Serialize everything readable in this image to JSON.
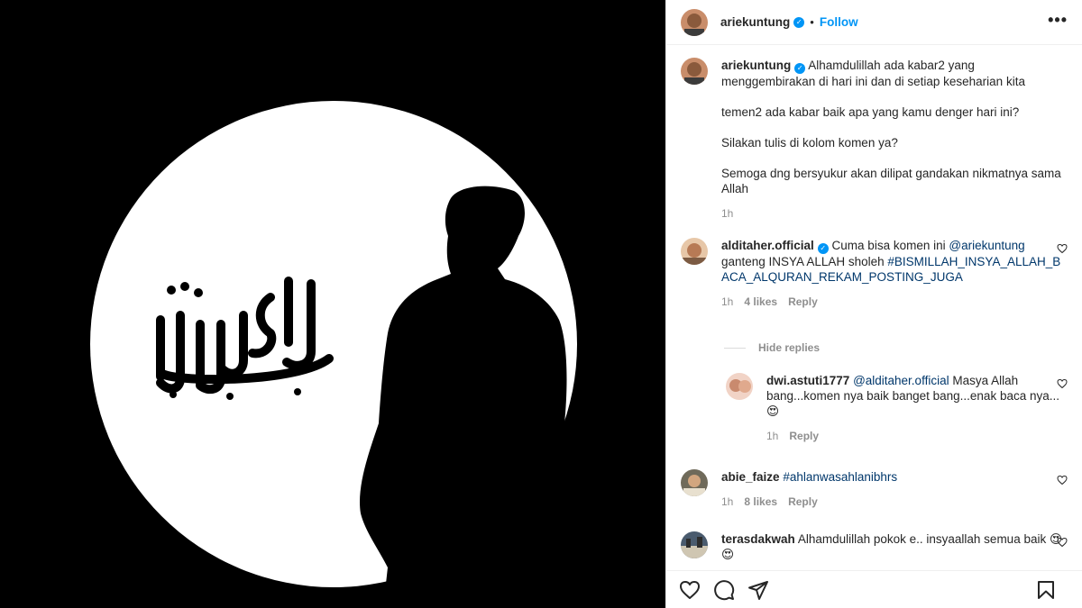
{
  "post": {
    "author": "ariekuntung",
    "verified_icon": "verified-badge-icon",
    "follow_label": "Follow",
    "separator": "•",
    "more_label": "•••",
    "caption_paragraphs": [
      "Alhamdulillah ada kabar2 yang menggembirakan di hari ini dan di setiap keseharian kita",
      "temen2 ada kabar baik apa yang kamu denger hari ini?",
      "Silakan tulis di kolom komen ya?",
      "Semoga dng bersyukur akan dilipat gandakan nikmatnya sama Allah"
    ],
    "caption_time": "1h"
  },
  "comments": [
    {
      "user": "alditaher.official",
      "verified": true,
      "text_pre": "Cuma bisa komen ini ",
      "mention": "@ariekuntung",
      "text_mid": " ganteng INSYA ALLAH sholeh ",
      "hashtag": "#BISMILLAH_INSYA_ALLAH_BACA_ALQURAN_REKAM_POSTING_JUGA",
      "time": "1h",
      "likes": "4 likes",
      "reply": "Reply",
      "hide_replies": "Hide replies"
    },
    {
      "user": "dwi.astuti1777",
      "mention": "@alditaher.official",
      "text": " Masya Allah bang...komen nya baik banget bang...enak baca nya...😍",
      "time": "1h",
      "reply": "Reply"
    },
    {
      "user": "abie_faize",
      "hashtag": "#ahlanwasahlanibhrs",
      "time": "1h",
      "likes": "8 likes",
      "reply": "Reply"
    },
    {
      "user": "terasdakwah",
      "text": "Alhamdulillah pokok e.. insyaallah semua baik 😍😍"
    }
  ],
  "actions": {
    "like_icon": "heart-icon",
    "comment_icon": "comment-icon",
    "share_icon": "share-icon",
    "save_icon": "bookmark-icon"
  },
  "colors": {
    "accent": "#0095f6",
    "link": "#00376b",
    "muted": "#8e8e8e"
  }
}
